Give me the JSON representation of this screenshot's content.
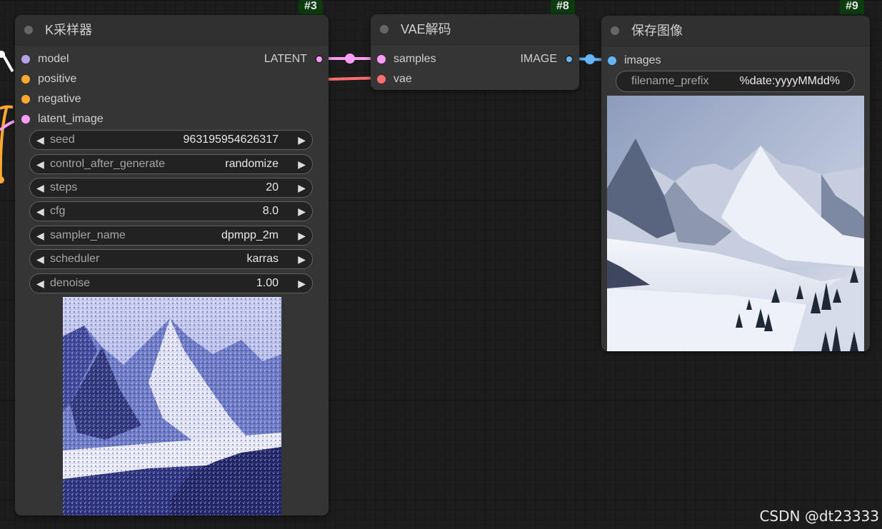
{
  "nodes": {
    "ksampler": {
      "title": "K采样器",
      "badge": "#3",
      "inputs": [
        "model",
        "positive",
        "negative",
        "latent_image"
      ],
      "output": "LATENT",
      "widgets": [
        {
          "name": "seed",
          "value": "963195954626317"
        },
        {
          "name": "control_after_generate",
          "value": "randomize"
        },
        {
          "name": "steps",
          "value": "20"
        },
        {
          "name": "cfg",
          "value": "8.0"
        },
        {
          "name": "sampler_name",
          "value": "dpmpp_2m"
        },
        {
          "name": "scheduler",
          "value": "karras"
        },
        {
          "name": "denoise",
          "value": "1.00"
        }
      ],
      "preview_icon": "noisy-mountain-preview"
    },
    "vae_decode": {
      "title": "VAE解码",
      "badge": "#8",
      "inputs": [
        "samples",
        "vae"
      ],
      "output": "IMAGE"
    },
    "save_image": {
      "title": "保存图像",
      "badge": "#9",
      "inputs": [
        "images"
      ],
      "filename_prefix": {
        "name": "filename_prefix",
        "value": "%date:yyyyMMdd%"
      },
      "preview_icon": "snowy-mountain-preview"
    }
  },
  "colors": {
    "model": "#b8a2e6",
    "conditioning": "#ffa931",
    "latent": "#ff9cf9",
    "vae": "#ff6e6e",
    "image": "#64b5f6",
    "node_bg": "#353535",
    "canvas_bg": "#1d1d1d",
    "badge_bg": "#0d3b10"
  },
  "watermark": "CSDN @dt23333"
}
